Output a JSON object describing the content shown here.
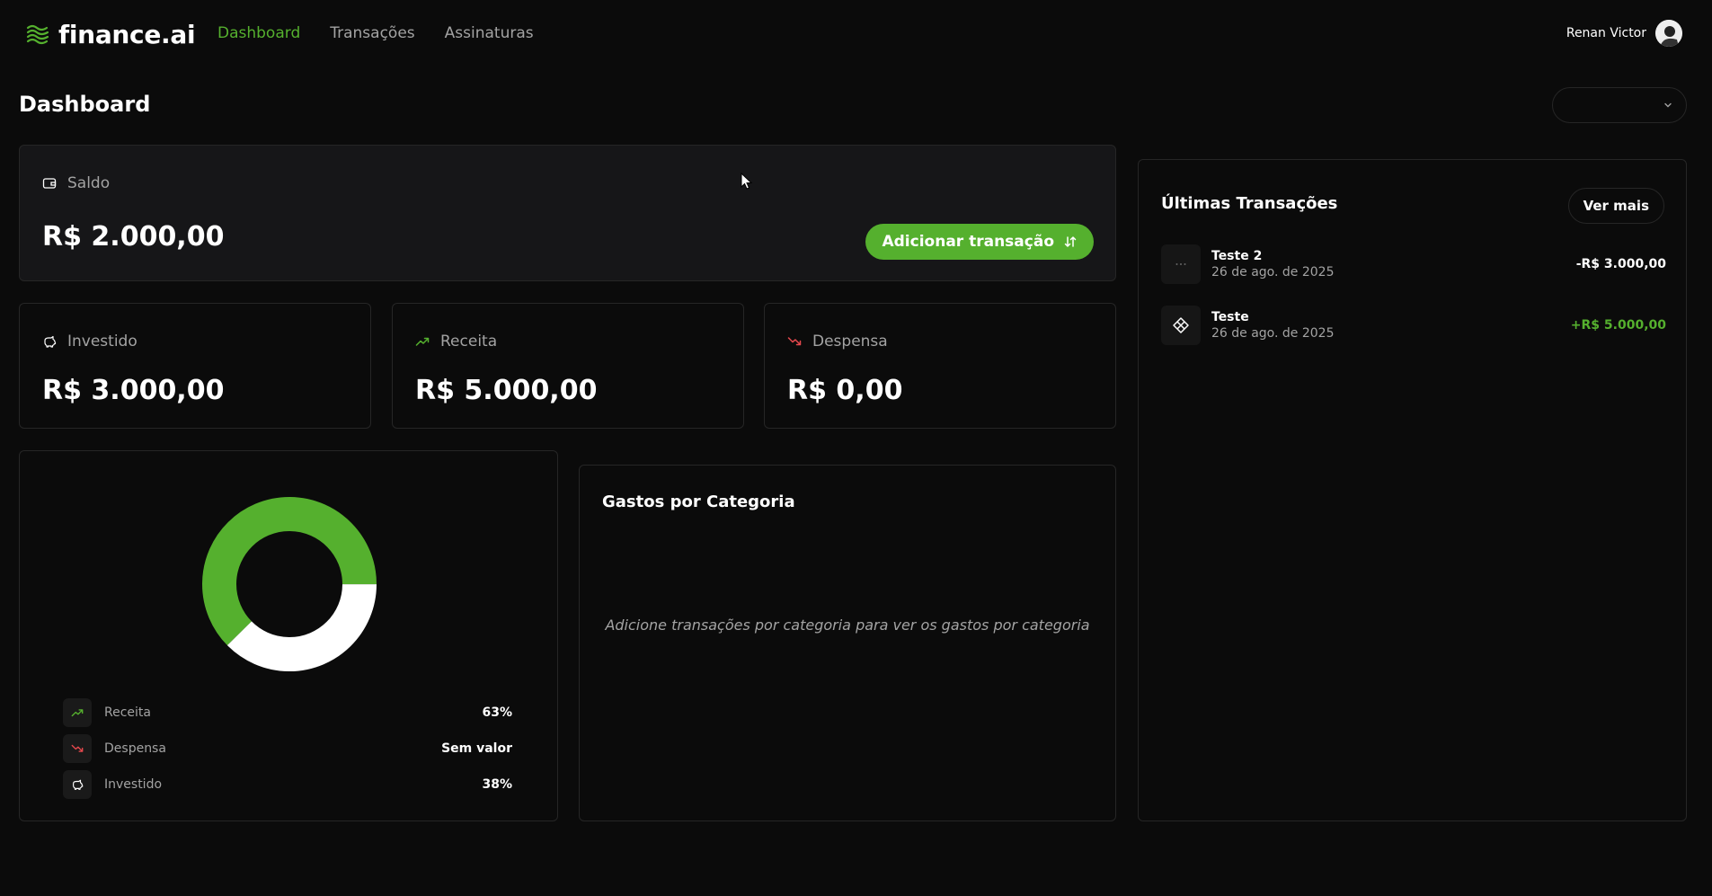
{
  "header": {
    "logo_text": "finance.ai",
    "nav": [
      {
        "label": "Dashboard",
        "active": true
      },
      {
        "label": "Transações",
        "active": false
      },
      {
        "label": "Assinaturas",
        "active": false
      }
    ],
    "user_name": "Renan Victor"
  },
  "page": {
    "title": "Dashboard",
    "month_select_value": ""
  },
  "saldo": {
    "label": "Saldo",
    "value": "R$ 2.000,00",
    "add_button_label": "Adicionar transação"
  },
  "summary": {
    "investido": {
      "label": "Investido",
      "value": "R$ 3.000,00"
    },
    "receita": {
      "label": "Receita",
      "value": "R$ 5.000,00"
    },
    "despensa": {
      "label": "Despensa",
      "value": "R$ 0,00"
    }
  },
  "chart_data": {
    "type": "pie",
    "categories": [
      "Receita",
      "Investido"
    ],
    "values": [
      63,
      38
    ],
    "legend": [
      {
        "label": "Receita",
        "value": "63%"
      },
      {
        "label": "Despensa",
        "value": "Sem valor"
      },
      {
        "label": "Investido",
        "value": "38%"
      }
    ],
    "colors": [
      "#55b02e",
      "#ffffff"
    ]
  },
  "gastos": {
    "title": "Gastos por Categoria",
    "empty_message": "Adicione transações por categoria para ver os gastos por categoria"
  },
  "ultimas": {
    "title": "Últimas Transações",
    "ver_mais_label": "Ver mais",
    "transactions": [
      {
        "name": "Teste 2",
        "date": "26 de ago. de 2025",
        "amount": "-R$ 3.000,00",
        "color": "#ffffff",
        "icon": "dots-icon"
      },
      {
        "name": "Teste",
        "date": "26 de ago. de 2025",
        "amount": "+R$ 5.000,00",
        "color": "#55b02e",
        "icon": "pix-icon"
      }
    ]
  },
  "colors": {
    "accent": "#55b02e",
    "expense": "#e5484d",
    "background": "#0b0b0b"
  }
}
